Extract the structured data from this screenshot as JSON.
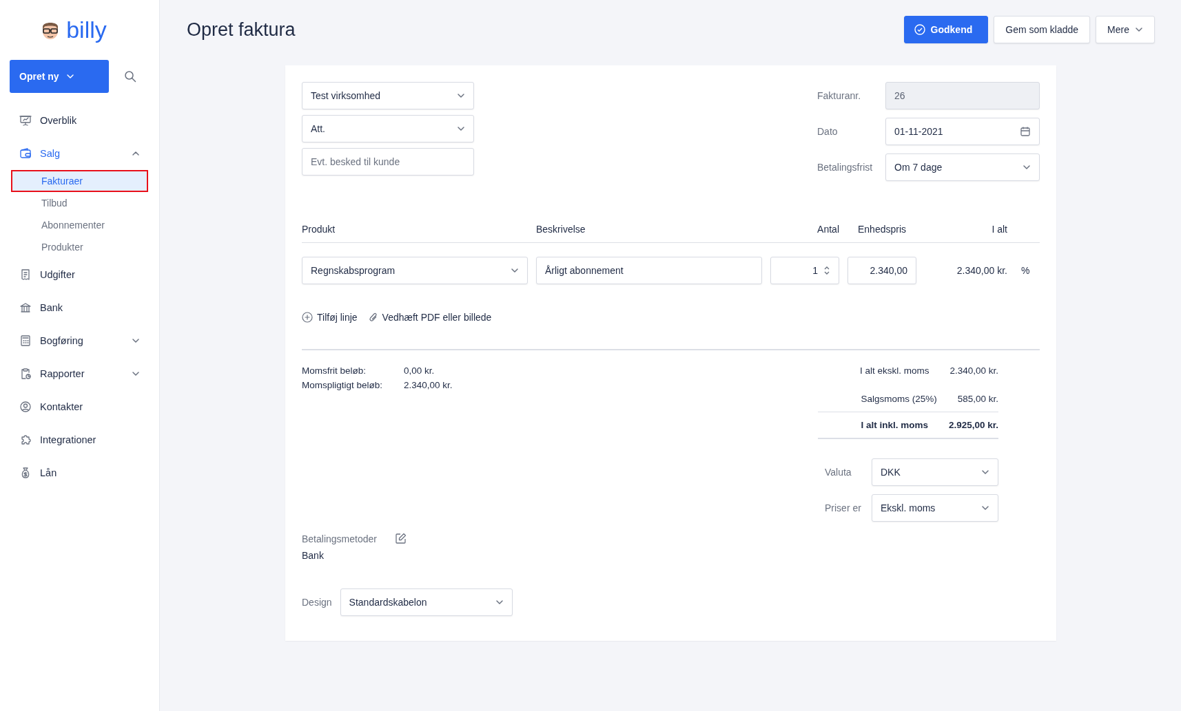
{
  "sidebar": {
    "logo": "billy",
    "create_button": "Opret ny",
    "nav": [
      {
        "label": "Overblik",
        "kind": "link",
        "selected": false
      },
      {
        "label": "Salg",
        "kind": "group",
        "selected": true,
        "expanded": true,
        "children": [
          {
            "label": "Fakturaer",
            "selected": true,
            "highlighted": true
          },
          {
            "label": "Tilbud",
            "selected": false,
            "highlighted": false
          },
          {
            "label": "Abonnementer",
            "selected": false,
            "highlighted": false
          },
          {
            "label": "Produkter",
            "selected": false,
            "highlighted": false
          }
        ]
      },
      {
        "label": "Udgifter",
        "kind": "link",
        "selected": false
      },
      {
        "label": "Bank",
        "kind": "link",
        "selected": false
      },
      {
        "label": "Bogføring",
        "kind": "group",
        "selected": false,
        "expanded": false
      },
      {
        "label": "Rapporter",
        "kind": "group",
        "selected": false,
        "expanded": false
      },
      {
        "label": "Kontakter",
        "kind": "link",
        "selected": false
      },
      {
        "label": "Integrationer",
        "kind": "link",
        "selected": false
      },
      {
        "label": "Lån",
        "kind": "link",
        "selected": false
      }
    ]
  },
  "page": {
    "title": "Opret faktura",
    "actions": [
      {
        "label": "Godkend",
        "kind": "primary"
      },
      {
        "label": "Gem som kladde",
        "kind": "secondary"
      },
      {
        "label": "Mere",
        "kind": "menu"
      }
    ]
  },
  "invoice": {
    "customer": {
      "value": "Test virksomhed"
    },
    "attention": {
      "value": "Att."
    },
    "message": {
      "placeholder": "Evt. besked til kunde"
    },
    "meta": [
      {
        "label": "Fakturanr.",
        "value": "26",
        "kind": "readonly"
      },
      {
        "label": "Dato",
        "value": "01-11-2021",
        "kind": "date"
      },
      {
        "label": "Betalingsfrist",
        "value": "Om 7 dage",
        "kind": "select"
      }
    ],
    "lines": {
      "columns": [
        "Produkt",
        "Beskrivelse",
        "Antal",
        "Enhedspris",
        "I alt"
      ],
      "rows": [
        {
          "product": "Regnskabsprogram",
          "description": "Årligt abonnement",
          "quantity": "1",
          "unit_price": "2.340,00",
          "total": "2.340,00 kr.",
          "discount_symbol": "%"
        }
      ]
    },
    "line_actions": [
      "Tilføj linje",
      "Vedhæft PDF eller billede"
    ],
    "vat_summary": [
      {
        "label": "Momsfrit beløb:",
        "value": "0,00 kr."
      },
      {
        "label": "Momspligtigt beløb:",
        "value": "2.340,00 kr."
      }
    ],
    "totals": [
      {
        "label": "I alt ekskl. moms",
        "value": "2.340,00 kr.",
        "kind": "subtotal"
      },
      {
        "label": "Salgsmoms (25%)",
        "value": "585,00 kr.",
        "kind": "subtotal"
      },
      {
        "label": "I alt inkl. moms",
        "value": "2.925,00 kr.",
        "kind": "total"
      }
    ],
    "settings": [
      {
        "label": "Valuta",
        "value": "DKK"
      },
      {
        "label": "Priser er",
        "value": "Ekskl. moms"
      }
    ],
    "payment_methods": {
      "label": "Betalingsmetoder",
      "value": "Bank"
    },
    "design": {
      "label": "Design",
      "value": "Standardskabelon"
    }
  }
}
